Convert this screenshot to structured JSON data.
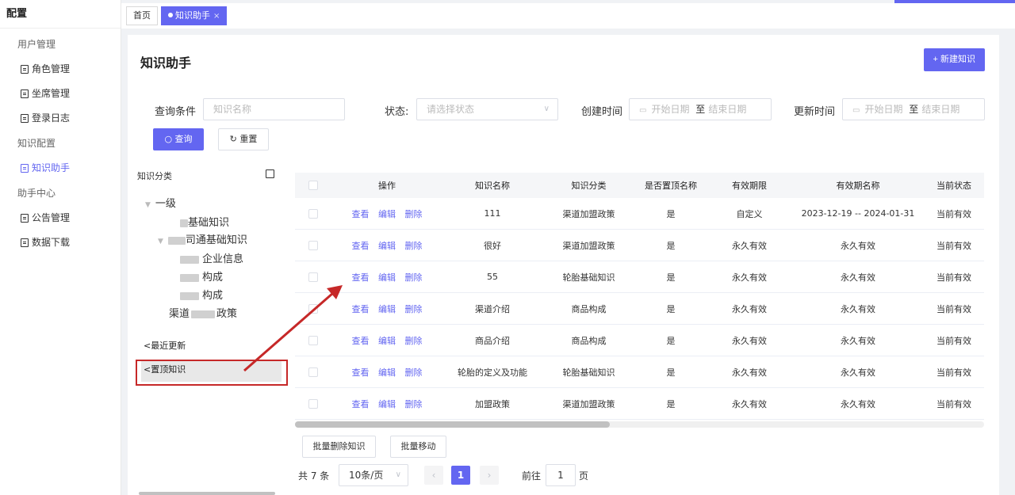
{
  "sidebar": {
    "brand": "配置",
    "groups": [
      {
        "label": "用户管理",
        "items": [
          "角色管理",
          "坐席管理",
          "登录日志"
        ]
      },
      {
        "label": "知识配置",
        "items": [
          "知识助手"
        ]
      },
      {
        "label": "助手中心",
        "items": [
          "公告管理",
          "数据下载"
        ]
      }
    ],
    "active_item": "知识助手"
  },
  "tabs": [
    {
      "label": "首页"
    },
    {
      "label": "知识助手",
      "close": "×"
    }
  ],
  "header": {
    "title": "知识助手",
    "new_button": "+ 新建知识"
  },
  "filters": {
    "query_label": "查询条件",
    "query_placeholder": "知识名称",
    "status_label": "状态:",
    "status_placeholder": "请选择状态",
    "created_label": "创建时间",
    "updated_label": "更新时间",
    "start_placeholder": "开始日期",
    "to": "至",
    "end_placeholder": "结束日期",
    "search_button": "查询",
    "reset_button": "重置"
  },
  "tree": {
    "heading": "知识分类",
    "root": "一级",
    "nodes": [
      "基础知识",
      "司通基础知识",
      "企业信息",
      "构成",
      "构成",
      "渠道",
      "政策"
    ],
    "recent": "最近更新",
    "pinned": "置顶知识"
  },
  "table": {
    "headers": [
      "操作",
      "知识名称",
      "知识分类",
      "是否置顶名称",
      "有效期限",
      "有效期名称",
      "当前状态"
    ],
    "ops": [
      "查看",
      "编辑",
      "删除"
    ],
    "rows": [
      {
        "name": "111",
        "category": "渠道加盟政策",
        "top": "是",
        "period": "自定义",
        "period_name": "2023-12-19 -- 2024-01-31",
        "status": "当前有效"
      },
      {
        "name": "很好",
        "category": "渠道加盟政策",
        "top": "是",
        "period": "永久有效",
        "period_name": "永久有效",
        "status": "当前有效"
      },
      {
        "name": "55",
        "category": "轮胎基础知识",
        "top": "是",
        "period": "永久有效",
        "period_name": "永久有效",
        "status": "当前有效"
      },
      {
        "name": "渠道介绍",
        "category": "商品构成",
        "top": "是",
        "period": "永久有效",
        "period_name": "永久有效",
        "status": "当前有效"
      },
      {
        "name": "商品介绍",
        "category": "商品构成",
        "top": "是",
        "period": "永久有效",
        "period_name": "永久有效",
        "status": "当前有效"
      },
      {
        "name": "轮胎的定义及功能",
        "category": "轮胎基础知识",
        "top": "是",
        "period": "永久有效",
        "period_name": "永久有效",
        "status": "当前有效"
      },
      {
        "name": "加盟政策",
        "category": "渠道加盟政策",
        "top": "是",
        "period": "永久有效",
        "period_name": "永久有效",
        "status": "当前有效"
      }
    ]
  },
  "bulk": {
    "delete": "批量删除知识",
    "move": "批量移动"
  },
  "pager": {
    "total": "共 7 条",
    "page_size": "10条/页",
    "current": "1",
    "goto": "前往",
    "goto_value": "1",
    "page_unit": "页"
  },
  "colors": {
    "accent": "#6366f1",
    "annotation": "#c62828"
  }
}
